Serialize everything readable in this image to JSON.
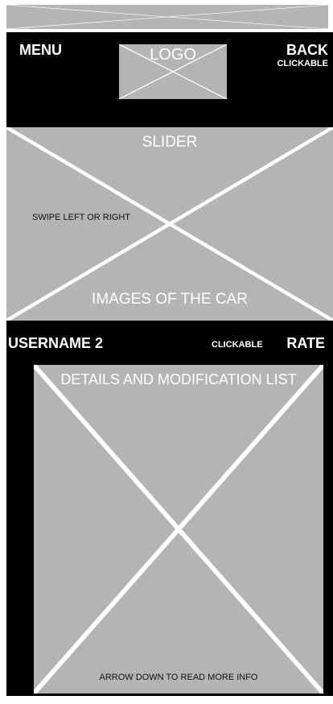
{
  "status_bar": {
    "icon": "placeholder-x-icon"
  },
  "header": {
    "menu_label": "MENU",
    "logo_label": "LOGO",
    "back_label": "BACK",
    "back_sublabel": "CLICKABLE"
  },
  "slider": {
    "title": "SLIDER",
    "hint": "SWIPE LEFT OR RIGHT",
    "caption": "IMAGES OF THE CAR"
  },
  "info": {
    "username": "USERNAME 2",
    "clickable_label": "CLICKABLE",
    "rate_label": "RATE",
    "details_title": "DETAILS AND MODIFICATION LIST",
    "details_hint": "ARROW DOWN TO READ MORE INFO"
  },
  "colors": {
    "placeholder": "#b4b4b4",
    "dark_band": "#000000",
    "text_light": "#ffffff"
  }
}
